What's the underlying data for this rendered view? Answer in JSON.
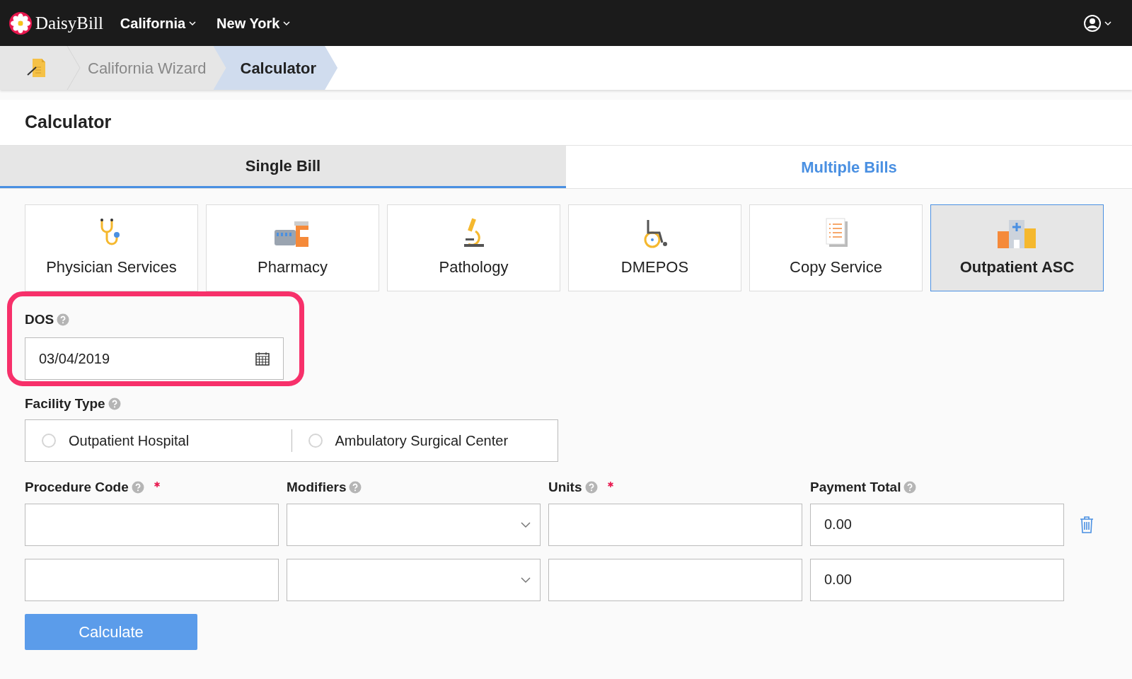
{
  "navbar": {
    "brand": "DaisyBill",
    "menus": [
      "California",
      "New York"
    ]
  },
  "breadcrumbs": [
    {
      "label": "California Wizard",
      "selected": false
    },
    {
      "label": "Calculator",
      "selected": true
    }
  ],
  "page_title": "Calculator",
  "tabs": [
    {
      "label": "Single Bill",
      "selected": true
    },
    {
      "label": "Multiple Bills",
      "selected": false
    }
  ],
  "categories": [
    {
      "label": "Physician Services",
      "kind": "physician",
      "selected": false
    },
    {
      "label": "Pharmacy",
      "kind": "pharmacy",
      "selected": false
    },
    {
      "label": "Pathology",
      "kind": "pathology",
      "selected": false
    },
    {
      "label": "DMEPOS",
      "kind": "dmepos",
      "selected": false
    },
    {
      "label": "Copy Service",
      "kind": "copy",
      "selected": false
    },
    {
      "label": "Outpatient ASC",
      "kind": "asc",
      "selected": true
    }
  ],
  "dos": {
    "label": "DOS",
    "value": "03/04/2019"
  },
  "facility_type": {
    "label": "Facility Type",
    "options": [
      {
        "label": "Outpatient Hospital",
        "selected": false
      },
      {
        "label": "Ambulatory Surgical Center",
        "selected": false
      }
    ]
  },
  "columns": [
    {
      "label": "Procedure Code",
      "required": true
    },
    {
      "label": "Modifiers",
      "required": false
    },
    {
      "label": "Units",
      "required": true
    },
    {
      "label": "Payment Total",
      "required": false
    }
  ],
  "rows": [
    {
      "payment_total": "0.00",
      "deletable": true
    },
    {
      "payment_total": "0.00",
      "deletable": false
    }
  ],
  "button": "Calculate"
}
